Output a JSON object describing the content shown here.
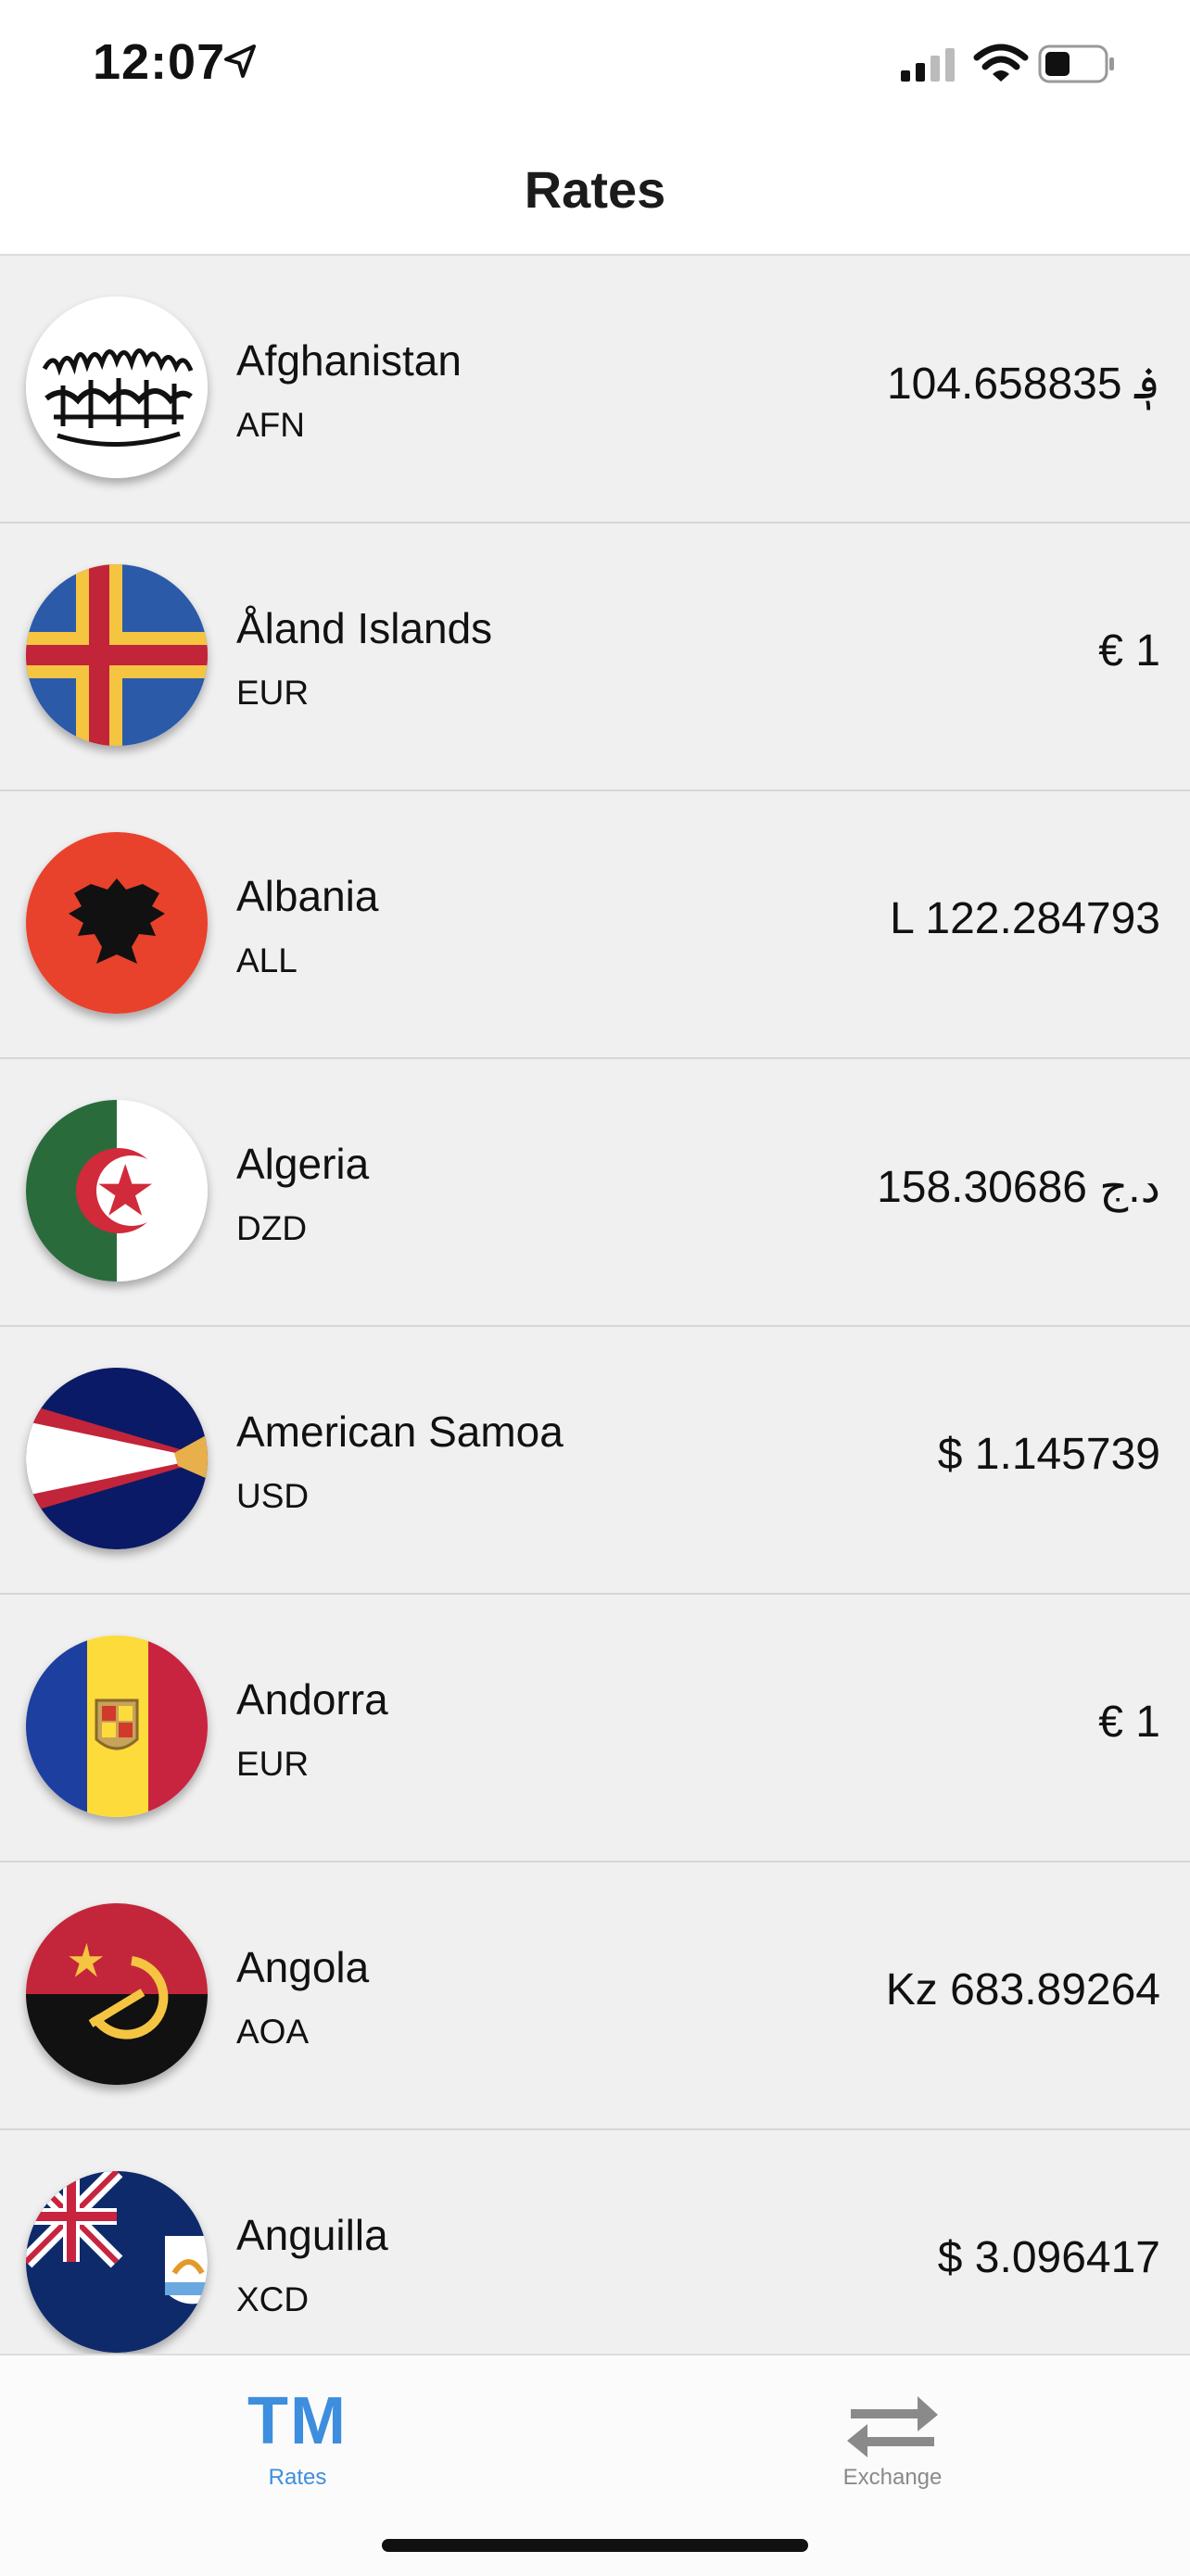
{
  "status_bar": {
    "time": "12:07"
  },
  "nav": {
    "title": "Rates"
  },
  "rates": [
    {
      "country": "Afghanistan",
      "code": "AFN",
      "rate": "104.658835 ؋",
      "flag": "afghanistan-flag"
    },
    {
      "country": "Åland Islands",
      "code": "EUR",
      "rate": "€ 1",
      "flag": "aland-islands-flag"
    },
    {
      "country": "Albania",
      "code": "ALL",
      "rate": "L 122.284793",
      "flag": "albania-flag"
    },
    {
      "country": "Algeria",
      "code": "DZD",
      "rate": "158.30686 د.ج",
      "flag": "algeria-flag"
    },
    {
      "country": "American Samoa",
      "code": "USD",
      "rate": "$ 1.145739",
      "flag": "american-samoa-flag"
    },
    {
      "country": "Andorra",
      "code": "EUR",
      "rate": "€ 1",
      "flag": "andorra-flag"
    },
    {
      "country": "Angola",
      "code": "AOA",
      "rate": "Kz 683.89264",
      "flag": "angola-flag"
    },
    {
      "country": "Anguilla",
      "code": "XCD",
      "rate": "$ 3.096417",
      "flag": "anguilla-flag"
    }
  ],
  "tabs": [
    {
      "label": "Rates",
      "icon_text": "TM",
      "active": true
    },
    {
      "label": "Exchange",
      "icon": "exchange-arrows-icon",
      "active": false
    }
  ],
  "colors": {
    "accent": "#3d8ede",
    "inactive_tab": "#8a8a8a",
    "list_bg": "#f0f0f0"
  }
}
